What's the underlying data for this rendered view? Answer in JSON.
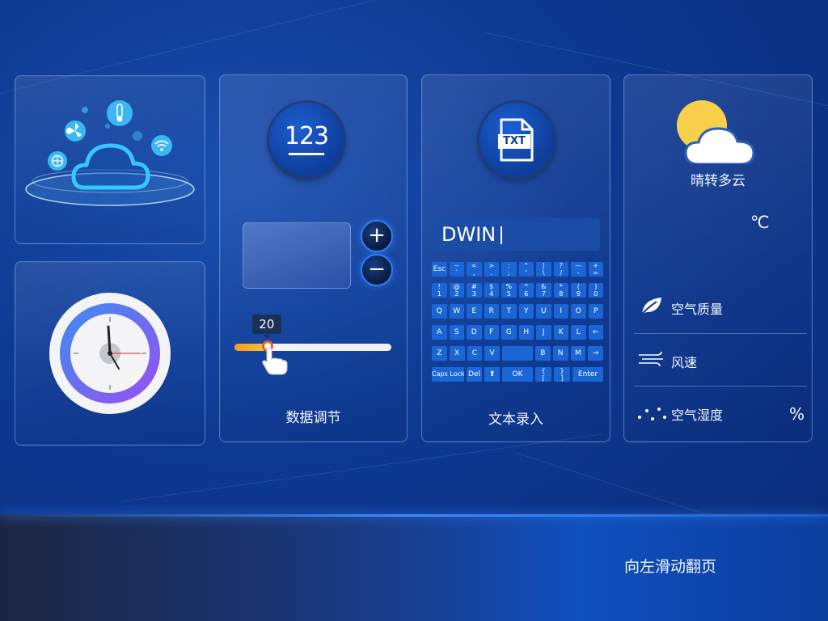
{
  "smart_home_card": {
    "icons": [
      "thermometer-icon",
      "fan-icon",
      "wifi-icon",
      "globe-icon",
      "cloud-icon"
    ]
  },
  "clock_card": {
    "icon": "clock-icon"
  },
  "data_adjust_card": {
    "badge_text": "123",
    "plus_label": "+",
    "minus_label": "−",
    "slider_value": "20",
    "slider_fraction": 0.21,
    "label": "数据调节"
  },
  "text_input_card": {
    "badge_text": "TXT",
    "input_value": "DWIN",
    "keyboard": [
      [
        {
          "k": "Esc"
        },
        {
          "k": "~\n`"
        },
        {
          "k": "<\n,"
        },
        {
          "k": ">\n."
        },
        {
          "k": ":\n;"
        },
        {
          "k": "\"\n'"
        },
        {
          "k": "|\n\\"
        },
        {
          "k": "?\n/"
        },
        {
          "k": "—\n-"
        },
        {
          "k": "+\n="
        }
      ],
      [
        {
          "k": "!\n1"
        },
        {
          "k": "@\n2"
        },
        {
          "k": "#\n3"
        },
        {
          "k": "$\n4"
        },
        {
          "k": "%\n5"
        },
        {
          "k": "^\n6"
        },
        {
          "k": "&\n7"
        },
        {
          "k": "*\n8"
        },
        {
          "k": "(\n9"
        },
        {
          "k": ")\n0"
        }
      ],
      [
        {
          "k": "Q"
        },
        {
          "k": "W"
        },
        {
          "k": "E"
        },
        {
          "k": "R"
        },
        {
          "k": "T"
        },
        {
          "k": "Y"
        },
        {
          "k": "U"
        },
        {
          "k": "I"
        },
        {
          "k": "O"
        },
        {
          "k": "P"
        }
      ],
      [
        {
          "k": "A"
        },
        {
          "k": "S"
        },
        {
          "k": "D"
        },
        {
          "k": "F"
        },
        {
          "k": "G"
        },
        {
          "k": "H"
        },
        {
          "k": "J"
        },
        {
          "k": "K"
        },
        {
          "k": "L"
        },
        {
          "k": "←"
        }
      ],
      [
        {
          "k": "Z"
        },
        {
          "k": "X"
        },
        {
          "k": "C"
        },
        {
          "k": "V"
        },
        {
          "k": ""
        },
        {
          "k": "B"
        },
        {
          "k": "N"
        },
        {
          "k": "M"
        },
        {
          "k": "→"
        }
      ],
      [
        {
          "k": "Caps Lock"
        },
        {
          "k": "Del"
        },
        {
          "k": "⬆"
        },
        {
          "k": "OK"
        },
        {
          "k": "{\n["
        },
        {
          "k": "}\n]"
        },
        {
          "k": "Enter"
        }
      ]
    ],
    "label": "文本录入"
  },
  "weather_card": {
    "condition": "晴转多云",
    "temp_unit": "℃",
    "air_quality_label": "空气质量",
    "wind_label": "风速",
    "humidity_label": "空气湿度",
    "humidity_unit": "%",
    "icons": [
      "partly-cloudy-icon",
      "leaf-icon",
      "wind-icon",
      "humidity-icon"
    ]
  },
  "footer": {
    "swipe_hint": "向左滑动翻页"
  },
  "colors": {
    "background": "#0e3a93",
    "accent": "#2e7cff",
    "key": "#1b66d6",
    "slider_fill": "#f39a1c"
  }
}
